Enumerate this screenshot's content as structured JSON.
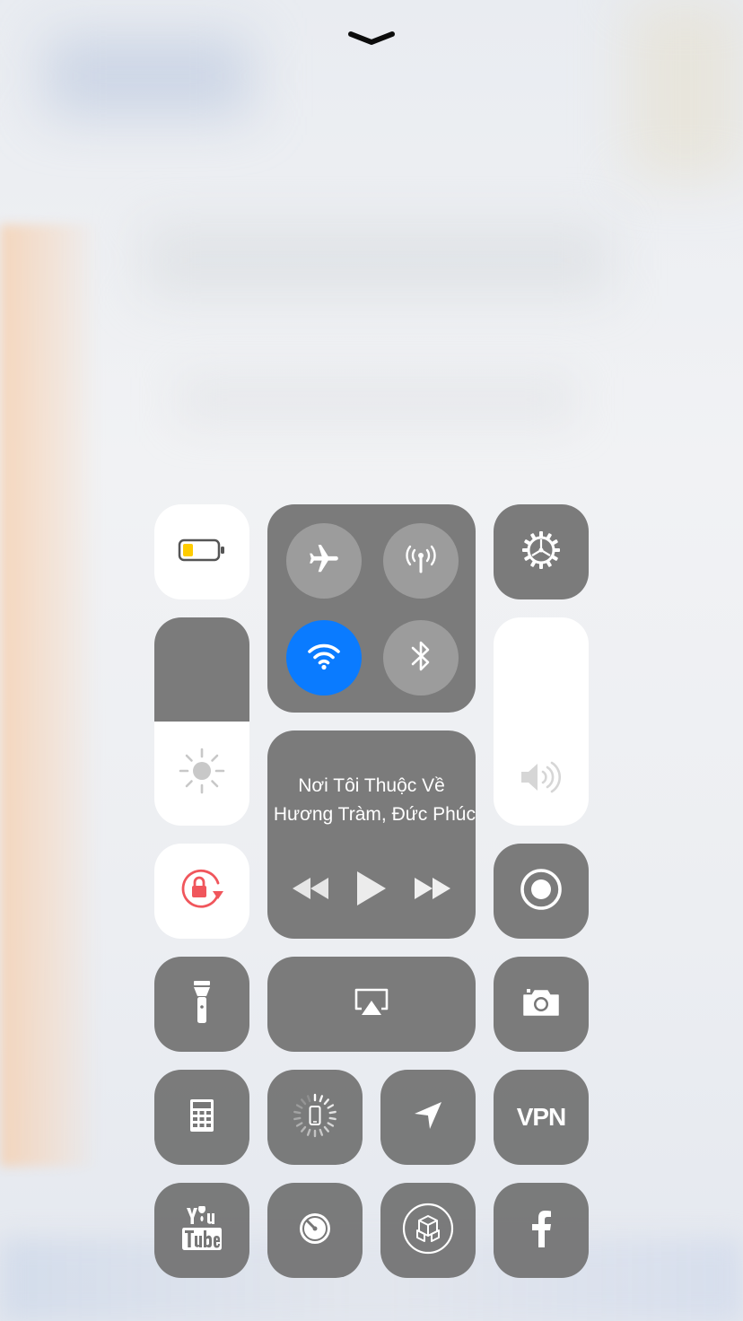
{
  "control_center": {
    "dismiss_icon": "chevron-down-icon",
    "battery_icon": "battery-low-icon",
    "battery_level": 0.3,
    "brightness_level": 0.5,
    "volume_level": 1.0,
    "connectivity": {
      "airplane_mode": false,
      "cellular_data": false,
      "wifi": true,
      "bluetooth": false
    },
    "now_playing": {
      "title": "Nơi Tôi Thuộc Về",
      "artist": "Tiến Minh, Hương Tràm, Đức Phúc"
    },
    "vpn_label": "VPN",
    "colors": {
      "accent_blue": "#0a7bff",
      "battery_yellow": "#ffcc00",
      "lock_red": "#f0565c",
      "tile_gray": "#767676",
      "button_gray": "#9e9e9e"
    }
  }
}
